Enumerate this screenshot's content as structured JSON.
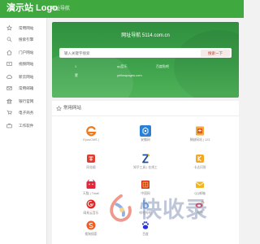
{
  "header": {
    "logo": "演示站 Logo",
    "subtitle": "网址导航"
  },
  "sidebar": {
    "items": [
      {
        "label": "常用网站",
        "icon": "star-icon"
      },
      {
        "label": "搜索引擎",
        "icon": "search-icon"
      },
      {
        "label": "门户网站",
        "icon": "home-icon"
      },
      {
        "label": "视频网站",
        "icon": "video-icon"
      },
      {
        "label": "新云网站",
        "icon": "cloud-icon"
      },
      {
        "label": "常用邮箱",
        "icon": "mail-icon"
      },
      {
        "label": "银行官网",
        "icon": "bank-icon"
      },
      {
        "label": "电子商务",
        "icon": "cart-icon"
      },
      {
        "label": "工作软件",
        "icon": "briefcase-icon"
      }
    ]
  },
  "hero": {
    "title": "网址导航 5114.com.cn",
    "search_placeholder": "输入关键字搜索",
    "search_button": "搜索一下",
    "quick_links": [
      "1",
      "qq音乐",
      "百度贴吧",
      "蒙",
      "yellowpages.com"
    ]
  },
  "panel": {
    "title": "常用网站",
    "icon": "star-icon"
  },
  "sites": [
    {
      "label": "EyouCMS | ",
      "icon": "eyoucms-icon"
    },
    {
      "label": "安徽网",
      "icon": "anhui-site-icon"
    },
    {
      "label": "稀缺网站 | 123",
      "icon": "rare-site-icon"
    },
    {
      "label": "同花顺",
      "icon": "tonghuashun-icon"
    },
    {
      "label": "知乎工具 | 在线工",
      "icon": "zhihu-tool-icon"
    },
    {
      "label": "卡达问答",
      "icon": "kada-icon"
    },
    {
      "label": "天猫 | Tmall",
      "icon": "tmall-icon"
    },
    {
      "label": "中国网",
      "icon": "china-net-icon"
    },
    {
      "label": "QQ邮箱",
      "icon": "qq-mail-icon"
    },
    {
      "label": "网易云音乐",
      "icon": "netease-music-icon"
    },
    {
      "label": "哔哩哔哩",
      "icon": "bilibili-icon"
    },
    {
      "label": "微博",
      "icon": "weibo-icon"
    },
    {
      "label": "搜狗搜索",
      "icon": "sogou-icon"
    },
    {
      "label": "百度",
      "icon": "baidu-icon"
    }
  ],
  "watermark": {
    "text": "快收录"
  }
}
